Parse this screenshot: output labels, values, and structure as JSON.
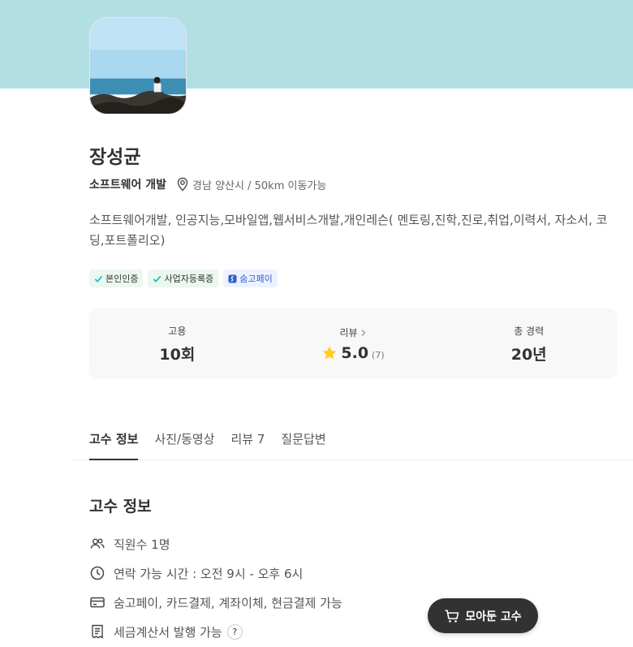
{
  "profile": {
    "name": "장성균",
    "category": "소프트웨어 개발",
    "location": "경남 양산시 / 50km 이동가능",
    "description": "소프트웨어개발, 인공지능,모바일앱,웹서비스개발,개인레슨( 멘토링,진학,진로,취업,이력서, 자소서, 코딩,포트폴리오)"
  },
  "badges": [
    {
      "label": "본인인증",
      "icon": "check-icon"
    },
    {
      "label": "사업자등록증",
      "icon": "check-icon"
    },
    {
      "label": "숨고페이",
      "icon": "soomgo-pay-icon"
    }
  ],
  "stats": {
    "hire_label": "고용",
    "hire_value": "10회",
    "review_label": "리뷰",
    "review_rating": "5.0",
    "review_count": "(7)",
    "career_label": "총 경력",
    "career_value": "20년"
  },
  "tabs": [
    {
      "label": "고수 정보",
      "active": true
    },
    {
      "label": "사진/동영상",
      "active": false
    },
    {
      "label": "리뷰 7",
      "active": false
    },
    {
      "label": "질문답변",
      "active": false
    }
  ],
  "info": {
    "title": "고수 정보",
    "employees": "직원수 1명",
    "contact_hours": "연락 가능 시간 : 오전 9시 - 오후 6시",
    "payment": "숨고페이, 카드결제, 계좌이체, 현금결제 가능",
    "tax_invoice": "세금계산서 발행 가능",
    "help_mark": "?"
  },
  "fab": {
    "label": "모아둔 고수"
  },
  "colors": {
    "banner": "#b2dfe4",
    "check": "#00c7ae",
    "pay": "#2f5fd0",
    "star": "#ffce21",
    "fab": "#323232"
  }
}
